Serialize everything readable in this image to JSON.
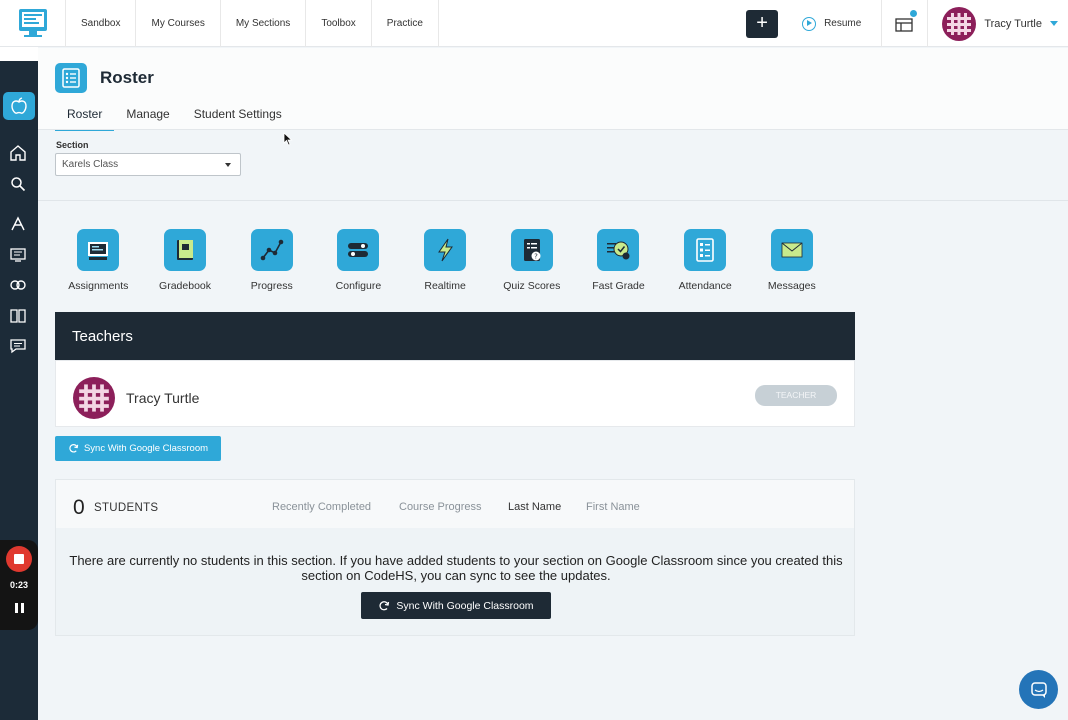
{
  "nav": {
    "items": [
      {
        "label": "Sandbox"
      },
      {
        "label": "My Courses"
      },
      {
        "label": "My Sections"
      },
      {
        "label": "Toolbox"
      },
      {
        "label": "Practice"
      }
    ],
    "resume_label": "Resume",
    "user_name": "Tracy Turtle",
    "accent_color": "#2fa8d8",
    "dark_color": "#1e2a35"
  },
  "sidebar": {
    "icons": [
      "apple-icon",
      "home-icon",
      "search-icon",
      "lesson-icon",
      "course-icon",
      "stethoscope-icon",
      "book-icon",
      "chat-icon"
    ],
    "recorder_time": "0:23"
  },
  "page": {
    "title": "Roster",
    "tabs": [
      {
        "label": "Roster",
        "active": true
      },
      {
        "label": "Manage",
        "active": false
      },
      {
        "label": "Student Settings",
        "active": false
      }
    ]
  },
  "section": {
    "label": "Section",
    "selected": "Karels Class"
  },
  "tools": [
    {
      "label": "Assignments",
      "icon": "assignments-icon"
    },
    {
      "label": "Gradebook",
      "icon": "gradebook-icon"
    },
    {
      "label": "Progress",
      "icon": "progress-icon"
    },
    {
      "label": "Configure",
      "icon": "configure-icon"
    },
    {
      "label": "Realtime",
      "icon": "realtime-icon"
    },
    {
      "label": "Quiz Scores",
      "icon": "quiz-scores-icon"
    },
    {
      "label": "Fast Grade",
      "icon": "fast-grade-icon"
    },
    {
      "label": "Attendance",
      "icon": "attendance-icon"
    },
    {
      "label": "Messages",
      "icon": "messages-icon"
    }
  ],
  "teachers": {
    "heading": "Teachers",
    "list": [
      {
        "name": "Tracy Turtle",
        "role": "TEACHER"
      }
    ]
  },
  "sync": {
    "top_label": "Sync With Google Classroom",
    "bottom_label": "Sync With Google Classroom"
  },
  "students": {
    "count": "0",
    "label": "STUDENTS",
    "sort_options": [
      {
        "label": "Recently Completed"
      },
      {
        "label": "Course Progress"
      },
      {
        "label": "Last Name"
      },
      {
        "label": "First Name"
      }
    ],
    "empty_message": "There are currently no students in this section. If you have added students to your section on Google Classroom since you created this section on CodeHS, you can sync to see the updates."
  }
}
